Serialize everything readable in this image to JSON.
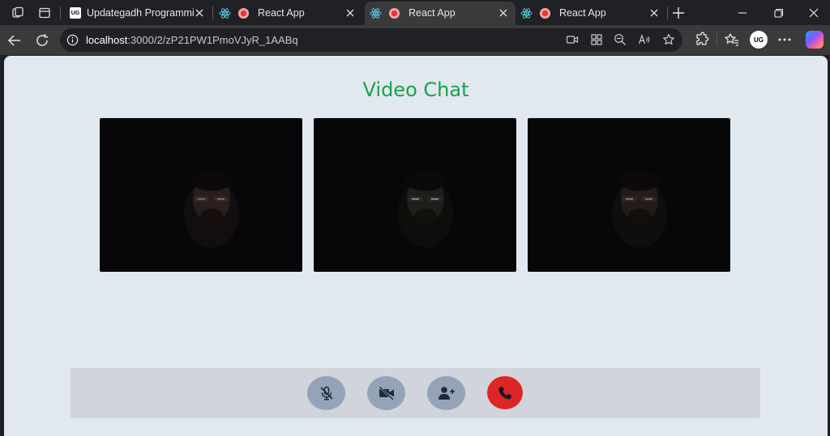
{
  "tabs": [
    {
      "title": "Updategadh Programming",
      "favicon": "ug-logo-icon"
    },
    {
      "title": "React App",
      "favicon": "react-icon"
    },
    {
      "title": "React App",
      "favicon": "react-icon",
      "active": true
    },
    {
      "title": "React App",
      "favicon": "react-icon"
    }
  ],
  "address": {
    "host": "localhost",
    "path": ":3000/2/zP21PW1PmoVJyR_1AABq"
  },
  "profile": {
    "initials": "UG"
  },
  "page": {
    "title": "Video Chat"
  },
  "videos": [
    "participant-1",
    "participant-2",
    "participant-3"
  ],
  "controls": [
    "mute-mic",
    "stop-video",
    "add-participant",
    "end-call"
  ],
  "colors": {
    "title": "#16a34a",
    "end_call": "#dc2626",
    "control": "#94a3b8",
    "bar": "#d1d5db",
    "page_bg": "#e2e8f0"
  }
}
